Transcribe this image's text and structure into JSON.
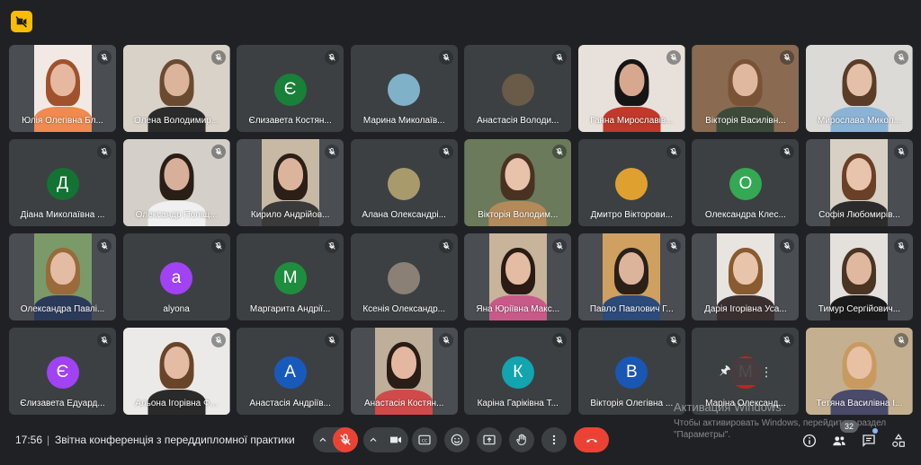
{
  "colors": {
    "background": "#202124",
    "tile": "#3c4043",
    "control": "#3c4043",
    "danger": "#ea4335",
    "badge": "#fbbc04"
  },
  "participants": [
    {
      "name": "Юлія Олегівна Бл...",
      "type": "video",
      "skin": "#e6b8a0",
      "hair": "#a0522d",
      "shirt": "#f08a50",
      "bg": "#f2e9e4",
      "wide": false
    },
    {
      "name": "Олена Володимир...",
      "type": "video",
      "skin": "#dcb49c",
      "hair": "#6b4a32",
      "shirt": "#2b2b2b",
      "bg": "#d9d2c8",
      "wide": true
    },
    {
      "name": "Єлизавета Костян...",
      "type": "initial",
      "initial": "Є",
      "color": "#188038"
    },
    {
      "name": "Марина Миколаїв...",
      "type": "photo",
      "color": "#7fb2c9"
    },
    {
      "name": "Анастасія Володи...",
      "type": "photo",
      "color": "#6a5a48"
    },
    {
      "name": "Ганна Мирославів...",
      "type": "video",
      "skin": "#d8a88e",
      "hair": "#151515",
      "shirt": "#c0392b",
      "bg": "#e8e0da",
      "wide": true
    },
    {
      "name": "Вікторія Василівн...",
      "type": "video",
      "skin": "#e0b8a0",
      "hair": "#7a5236",
      "shirt": "#3d4a3a",
      "bg": "#8a6a50",
      "wide": true
    },
    {
      "name": "Мирослава Микол...",
      "type": "video",
      "skin": "#e4c0a8",
      "hair": "#5a3c28",
      "shirt": "#8bb3d6",
      "bg": "#dcdad6",
      "wide": true
    },
    {
      "name": "Діана Миколаївна ...",
      "type": "initial",
      "initial": "Д",
      "color": "#137333"
    },
    {
      "name": "Олександр Поліщ...",
      "type": "video",
      "skin": "#d8b09a",
      "hair": "#2a1e18",
      "shirt": "#f0f0f0",
      "bg": "#d4cfc9",
      "wide": true
    },
    {
      "name": "Кирило Андрійов...",
      "type": "video",
      "skin": "#dcb49c",
      "hair": "#2b1f17",
      "shirt": "#3a3a3a",
      "bg": "#c7b9a4",
      "wide": false
    },
    {
      "name": "Алана Олександрі...",
      "type": "photo",
      "color": "#a89a6a"
    },
    {
      "name": "Вікторія Володим...",
      "type": "video",
      "skin": "#e8c2aa",
      "hair": "#4a3222",
      "shirt": "#b58a5a",
      "bg": "#6b7a5a",
      "wide": true
    },
    {
      "name": "Дмитро Вікторови...",
      "type": "photo",
      "color": "#e0a030"
    },
    {
      "name": "Олександра Клес...",
      "type": "initial",
      "initial": "О",
      "color": "#34a853"
    },
    {
      "name": "Софія Любомирів...",
      "type": "video",
      "skin": "#e8c4ac",
      "hair": "#6a4026",
      "shirt": "#2b2b2b",
      "bg": "#d8d0c4",
      "wide": false
    },
    {
      "name": "Олександра Павлі...",
      "type": "video",
      "skin": "#e4bca4",
      "hair": "#9a6a3a",
      "shirt": "#2c3a5a",
      "bg": "#7a9a6a",
      "wide": false
    },
    {
      "name": "alyona",
      "type": "initial",
      "initial": "a",
      "color": "#a142f4"
    },
    {
      "name": "Маргарита Андрії...",
      "type": "initial",
      "initial": "М",
      "color": "#1e8e3e"
    },
    {
      "name": "Ксенія Олександр...",
      "type": "photo",
      "color": "#8a8076"
    },
    {
      "name": "Яна Юріївна Макс...",
      "type": "video",
      "skin": "#e4bca4",
      "hair": "#2a1c14",
      "shirt": "#c85a8a",
      "bg": "#c8b49a",
      "wide": false
    },
    {
      "name": "Павло Павлович Г...",
      "type": "video",
      "skin": "#dcb49c",
      "hair": "#2a2018",
      "shirt": "#2c4a7a",
      "bg": "#d0a060",
      "wide": false
    },
    {
      "name": "Дарія Ігорівна Уса...",
      "type": "video",
      "skin": "#e8c4aa",
      "hair": "#8a5a30",
      "shirt": "#3a3030",
      "bg": "#e8e4e0",
      "wide": false
    },
    {
      "name": "Тимур Сергійович...",
      "type": "video",
      "skin": "#e0b8a0",
      "hair": "#4a3424",
      "shirt": "#1a1a1a",
      "bg": "#e4e0dc",
      "wide": false
    },
    {
      "name": "Єлизавета Едуард...",
      "type": "initial",
      "initial": "Є",
      "color": "#a142f4"
    },
    {
      "name": "Альона Ігорівна Ф...",
      "type": "video",
      "skin": "#e4bca4",
      "hair": "#6a4428",
      "shirt": "#2a2a2a",
      "bg": "#eceae8",
      "wide": true
    },
    {
      "name": "Анастасія Андріїв...",
      "type": "initial",
      "initial": "А",
      "color": "#185abc"
    },
    {
      "name": "Анастасія Костян...",
      "type": "video",
      "skin": "#e4b8a0",
      "hair": "#2a1c16",
      "shirt": "#d04a4a",
      "bg": "#bfae9a",
      "wide": false
    },
    {
      "name": "Каріна Гаріківна Т...",
      "type": "initial",
      "initial": "К",
      "color": "#12a4af"
    },
    {
      "name": "Вікторія Олегівна ...",
      "type": "initial",
      "initial": "В",
      "color": "#1a56b3"
    },
    {
      "name": "Маріна Олександ...",
      "type": "initial",
      "initial": "М",
      "color": "#c5221f",
      "hover": true
    },
    {
      "name": "Тетяна Василівна І...",
      "type": "video",
      "skin": "#e8c0a4",
      "hair": "#c89a60",
      "shirt": "#4a4a6a",
      "bg": "#c4b090",
      "wide": true
    }
  ],
  "watermark": {
    "title": "Активация Windows",
    "subtitle": "Чтобы активировать Windows, перейдите в раздел \"Параметры\"."
  },
  "bottom_bar": {
    "time": "17:56",
    "separator": "|",
    "meeting_title": "Звітна конференція з переддипломної практики",
    "people_count": "32"
  },
  "icons": {
    "top_badge": "camera-off-icon",
    "tile_status": "mic-off-icon",
    "hover_pin": "pin-icon",
    "hover_more": "more-vert-icon",
    "mic": "mic-off-icon",
    "camera": "camera-icon",
    "captions": "captions-icon",
    "emoji": "emoji-icon",
    "present": "present-screen-icon",
    "raise_hand": "raise-hand-icon",
    "more": "more-vert-icon",
    "leave": "end-call-icon",
    "info": "info-icon",
    "people": "people-icon",
    "chat": "chat-icon",
    "activities": "activities-icon"
  }
}
